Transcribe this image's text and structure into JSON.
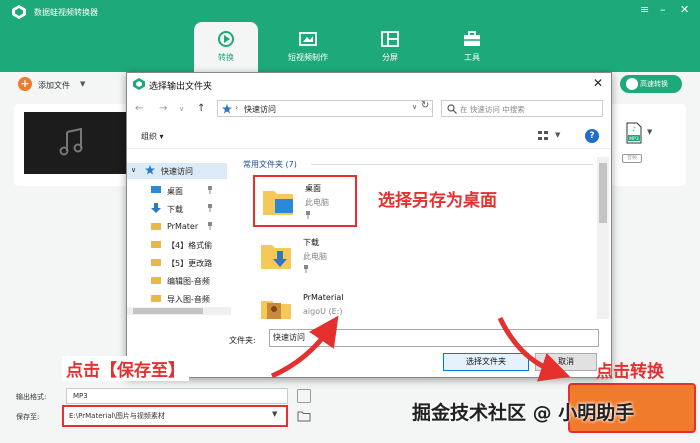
{
  "app": {
    "title": "数据蛙视频转换器",
    "tabs": [
      {
        "label": "转换",
        "icon": "convert-icon",
        "active": true
      },
      {
        "label": "短视频制作",
        "icon": "video-maker-icon",
        "active": false
      },
      {
        "label": "分屏",
        "icon": "split-screen-icon",
        "active": false
      },
      {
        "label": "工具",
        "icon": "toolbox-icon",
        "active": false
      }
    ],
    "accent_color": "#1ea97a"
  },
  "toolbar": {
    "add_file_label": "添加文件",
    "fast_convert_label": "高速转换"
  },
  "file_card": {
    "output_badge": "MP3",
    "badge_sub": "音频"
  },
  "bottom": {
    "format_label": "输出格式:",
    "format_value": "MP3",
    "save_label": "保存至:",
    "save_value": "E:\\PrMaterial\\图片与视频素材"
  },
  "dialog": {
    "title": "选择输出文件夹",
    "address": "快速访问",
    "search_placeholder": "在 快速访问 中搜索",
    "organize_label": "组织 ▾",
    "help_label": "?",
    "nav_items": [
      {
        "label": "快速访问",
        "icon": "star-icon",
        "selected": true
      },
      {
        "label": "桌面",
        "icon": "desktop-icon"
      },
      {
        "label": "下载",
        "icon": "download-icon"
      },
      {
        "label": "PrMater",
        "icon": "folder-icon"
      },
      {
        "label": "【4】格式偷",
        "icon": "folder-icon"
      },
      {
        "label": "【5】更改路",
        "icon": "folder-icon"
      },
      {
        "label": "编辑图-音频",
        "icon": "folder-icon"
      },
      {
        "label": "导入图-音频",
        "icon": "folder-icon"
      }
    ],
    "group_header": "常用文件夹 (7)",
    "folders": [
      {
        "name": "桌面",
        "sub": "此电脑",
        "icon": "desktop-folder-icon"
      },
      {
        "name": "下载",
        "sub": "此电脑",
        "icon": "download-folder-icon"
      },
      {
        "name": "PrMaterial",
        "sub": "aigoU (E:)",
        "icon": "media-folder-icon"
      }
    ],
    "folder_field_label": "文件夹:",
    "folder_field_value": "快速访问",
    "select_button": "选择文件夹",
    "cancel_button": "取消"
  },
  "annotations": {
    "desktop_hint": "选择另存为桌面",
    "save_hint": "点击【保存至】",
    "convert_hint": "点击转换",
    "color": "#e53030"
  },
  "watermark": "掘金技术社区 @ 小明助手"
}
